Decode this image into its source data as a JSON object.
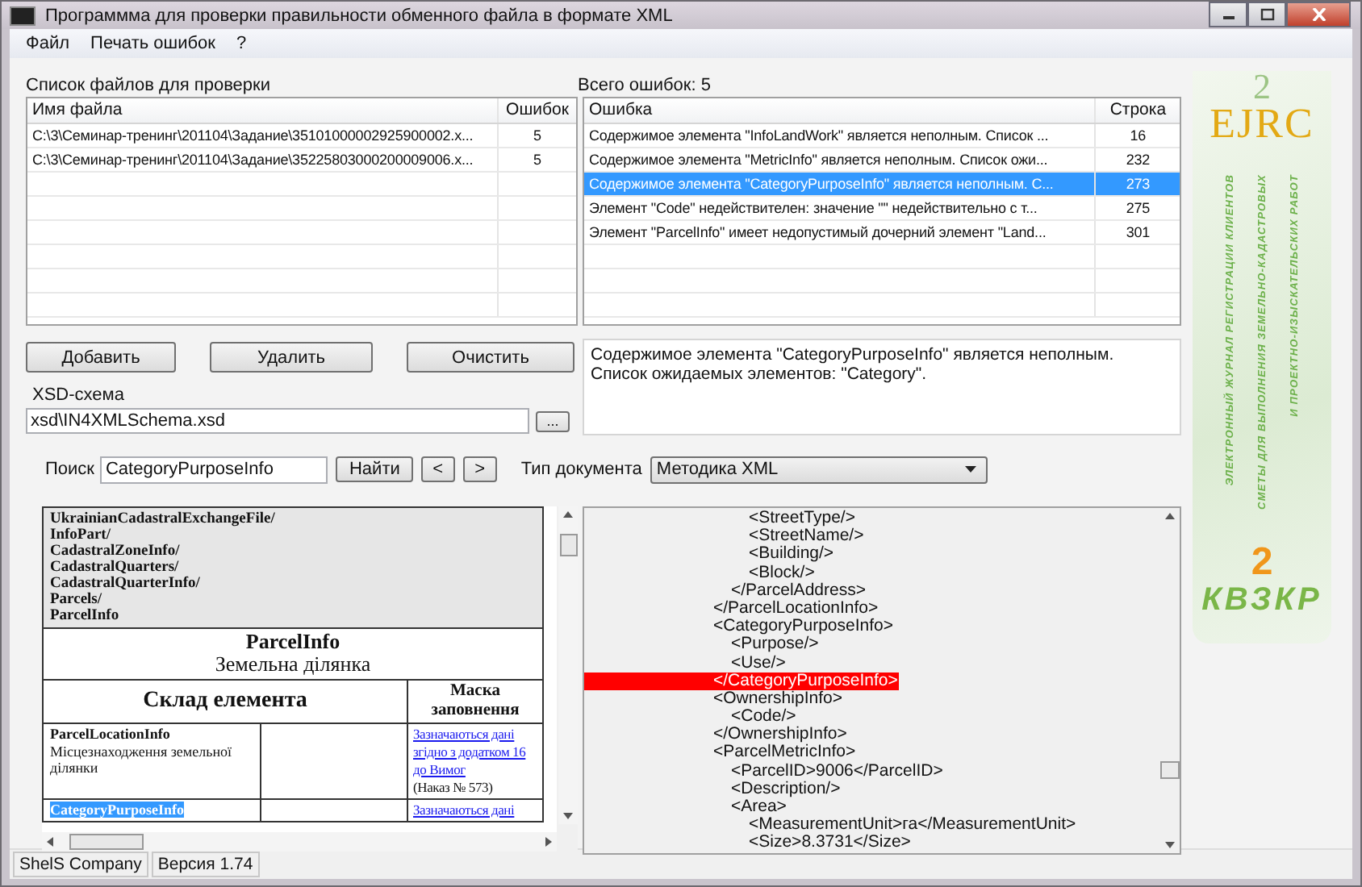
{
  "window": {
    "title": "Программма для проверки правильности  обменного файла в формате XML"
  },
  "menu": [
    "Файл",
    "Печать ошибок",
    "?"
  ],
  "files": {
    "label": "Список файлов для проверки",
    "columns": [
      "Имя файла",
      "Ошибок"
    ],
    "rows": [
      {
        "name": "C:\\3\\Семинар-тренинг\\201104\\Задание\\35101000002925900002.x...",
        "errors": "5"
      },
      {
        "name": "C:\\3\\Семинар-тренинг\\201104\\Задание\\35225803000200009006.x...",
        "errors": "5"
      }
    ]
  },
  "errors": {
    "label": "Всего ошибок: 5",
    "columns": [
      "Ошибка",
      "Строка"
    ],
    "rows": [
      {
        "message": "Содержимое элемента \"InfoLandWork\" является неполным. Список ...",
        "line": "16",
        "selected": false
      },
      {
        "message": "Содержимое элемента \"MetricInfo\" является неполным. Список ожи...",
        "line": "232",
        "selected": false
      },
      {
        "message": "Содержимое элемента \"CategoryPurposeInfo\" является неполным. С...",
        "line": "273",
        "selected": true
      },
      {
        "message": "Элемент \"Code\" недействителен: значение \"\" недействительно с т...",
        "line": "275",
        "selected": false
      },
      {
        "message": "Элемент \"ParcelInfo\" имеет недопустимый дочерний элемент \"Land...",
        "line": "301",
        "selected": false
      }
    ]
  },
  "buttons": [
    "Добавить",
    "Удалить",
    "Очистить"
  ],
  "error_detail": "Содержимое элемента \"CategoryPurposeInfo\" является неполным. Список ожидаемых элементов: \"Category\".",
  "xsd": {
    "label": "XSD-схема",
    "value": "xsd\\IN4XMLSchema.xsd",
    "browse": "..."
  },
  "search": {
    "label": "Поиск",
    "value": "CategoryPurposeInfo",
    "find": "Найти",
    "prev": "<",
    "next": ">"
  },
  "doc_type": {
    "label": "Тип документа",
    "value": "Методика XML"
  },
  "document": {
    "path": [
      "UkrainianCadastralExchangeFile/",
      "InfoPart/",
      "CadastralZoneInfo/",
      "CadastralQuarters/",
      "CadastralQuarterInfo/",
      "Parcels/",
      "ParcelInfo"
    ],
    "title": "ParcelInfo",
    "subtitle": "Земельна ділянка",
    "col_composition": "Склад елемента",
    "col_mask": "Маска заповнення",
    "rows": [
      {
        "name": "ParcelLocationInfo",
        "description": "Місцезнаходження земельної ділянки",
        "link": "Зазначаються дані згідно з додатком 16 до Вимог",
        "note": "(Наказ № 573)",
        "highlighted": false
      },
      {
        "name": "CategoryPurposeInfo",
        "link": "Зазначаються дані",
        "highlighted": true
      }
    ]
  },
  "xml": [
    {
      "close": "</ParcelLocationInfo>",
      "close_highlighted": false,
      "children": [
        {
          "close": "</ParcelAddress>",
          "close_highlighted": false,
          "children": [
            {
              "open": "<StreetType/>"
            },
            {
              "open": "<StreetName/>"
            },
            {
              "open": "<Building/>"
            },
            {
              "open": "<Block/>"
            }
          ]
        }
      ]
    },
    {
      "open": "<CategoryPurposeInfo>",
      "close": "</CategoryPurposeInfo>",
      "close_highlighted": true,
      "children": [
        {
          "open": "<Purpose/>"
        },
        {
          "open": "<Use/>"
        }
      ]
    },
    {
      "open": "<OwnershipInfo>",
      "close": "</OwnershipInfo>",
      "close_highlighted": false,
      "children": [
        {
          "open": "<Code/>"
        }
      ]
    },
    {
      "open": "<ParcelMetricInfo>",
      "children": [
        {
          "open": "<ParcelID>9006</ParcelID>"
        },
        {
          "open": "<Description/>"
        },
        {
          "open": "<Area>",
          "children": [
            {
              "open": "<MeasurementUnit>га</MeasurementUnit>"
            },
            {
              "open": "<Size>8.3731</Size>"
            }
          ]
        }
      ]
    }
  ],
  "banner": {
    "top": "EJRC",
    "top_digit": "2",
    "lines": [
      "ЭЛЕКТРОННЫЙ ЖУРНАЛ РЕГИСТРАЦИИ КЛИЕНТОВ",
      "СМЕТЫ ДЛЯ ВЫПОЛНЕНИЯ ЗЕМЕЛЬНО-КАДАСТРОВЫХ",
      "И ПРОЕКТНО-ИЗЫСКАТЕЛЬСКИХ РАБОТ"
    ],
    "bottom": "КВЗКР",
    "bottom_digit": "2"
  },
  "status_bar": [
    "ShelS Company",
    "Версия 1.74"
  ]
}
